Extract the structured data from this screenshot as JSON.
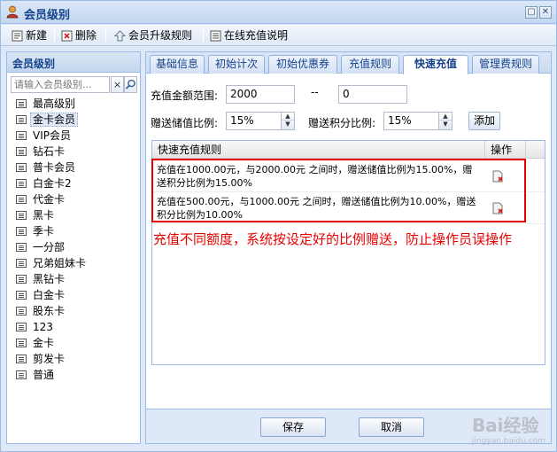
{
  "window": {
    "title": "会员级别",
    "minimize": "▢",
    "close": "✕"
  },
  "toolbar": {
    "new_label": "新建",
    "delete_label": "删除",
    "upgrade_rules_label": "会员升级规则",
    "online_recharge_label": "在线充值说明"
  },
  "sidebar": {
    "header": "会员级别",
    "search_placeholder": "请输入会员级别...",
    "clear": "×",
    "items": [
      {
        "label": "最高级别"
      },
      {
        "label": "金卡会员"
      },
      {
        "label": "VIP会员"
      },
      {
        "label": "钻石卡"
      },
      {
        "label": "普卡会员"
      },
      {
        "label": "白金卡2"
      },
      {
        "label": "代金卡"
      },
      {
        "label": "黑卡"
      },
      {
        "label": "季卡"
      },
      {
        "label": "一分部"
      },
      {
        "label": "兄弟姐妹卡"
      },
      {
        "label": "黑钻卡"
      },
      {
        "label": "白金卡"
      },
      {
        "label": "股东卡"
      },
      {
        "label": "123"
      },
      {
        "label": "金卡"
      },
      {
        "label": "剪发卡"
      },
      {
        "label": "普通"
      }
    ],
    "selected_index": 1
  },
  "tabs": [
    {
      "label": "基础信息"
    },
    {
      "label": "初始计次"
    },
    {
      "label": "初始优惠券"
    },
    {
      "label": "充值规则"
    },
    {
      "label": "快速充值"
    },
    {
      "label": "管理费规则"
    }
  ],
  "active_tab_index": 4,
  "form": {
    "range_label": "充值金额范围:",
    "range_min": "2000",
    "range_sep": "--",
    "range_max": "0",
    "stored_ratio_label": "赠送储值比例:",
    "stored_ratio": "15%",
    "points_ratio_label": "赠送积分比例:",
    "points_ratio": "15%",
    "add_label": "添加"
  },
  "grid": {
    "col_rule": "快速充值规则",
    "col_op": "操作",
    "rows": [
      {
        "rule": "充值在1000.00元，与2000.00元 之间时，赠送储值比例为15.00%，赠送积分比例为15.00%"
      },
      {
        "rule": "充值在500.00元，与1000.00元 之间时，赠送储值比例为10.00%，赠送积分比例为10.00%"
      }
    ]
  },
  "annotation": "充值不同额度，系统按设定好的比例赠送，防止操作员误操作",
  "buttons": {
    "save": "保存",
    "cancel": "取消"
  },
  "watermark": {
    "main": "Bai经验",
    "sub": "jingyan.baidu.com"
  },
  "colors": {
    "accent": "#15428b",
    "highlight_red": "#e60000",
    "border": "#99bbe8"
  }
}
